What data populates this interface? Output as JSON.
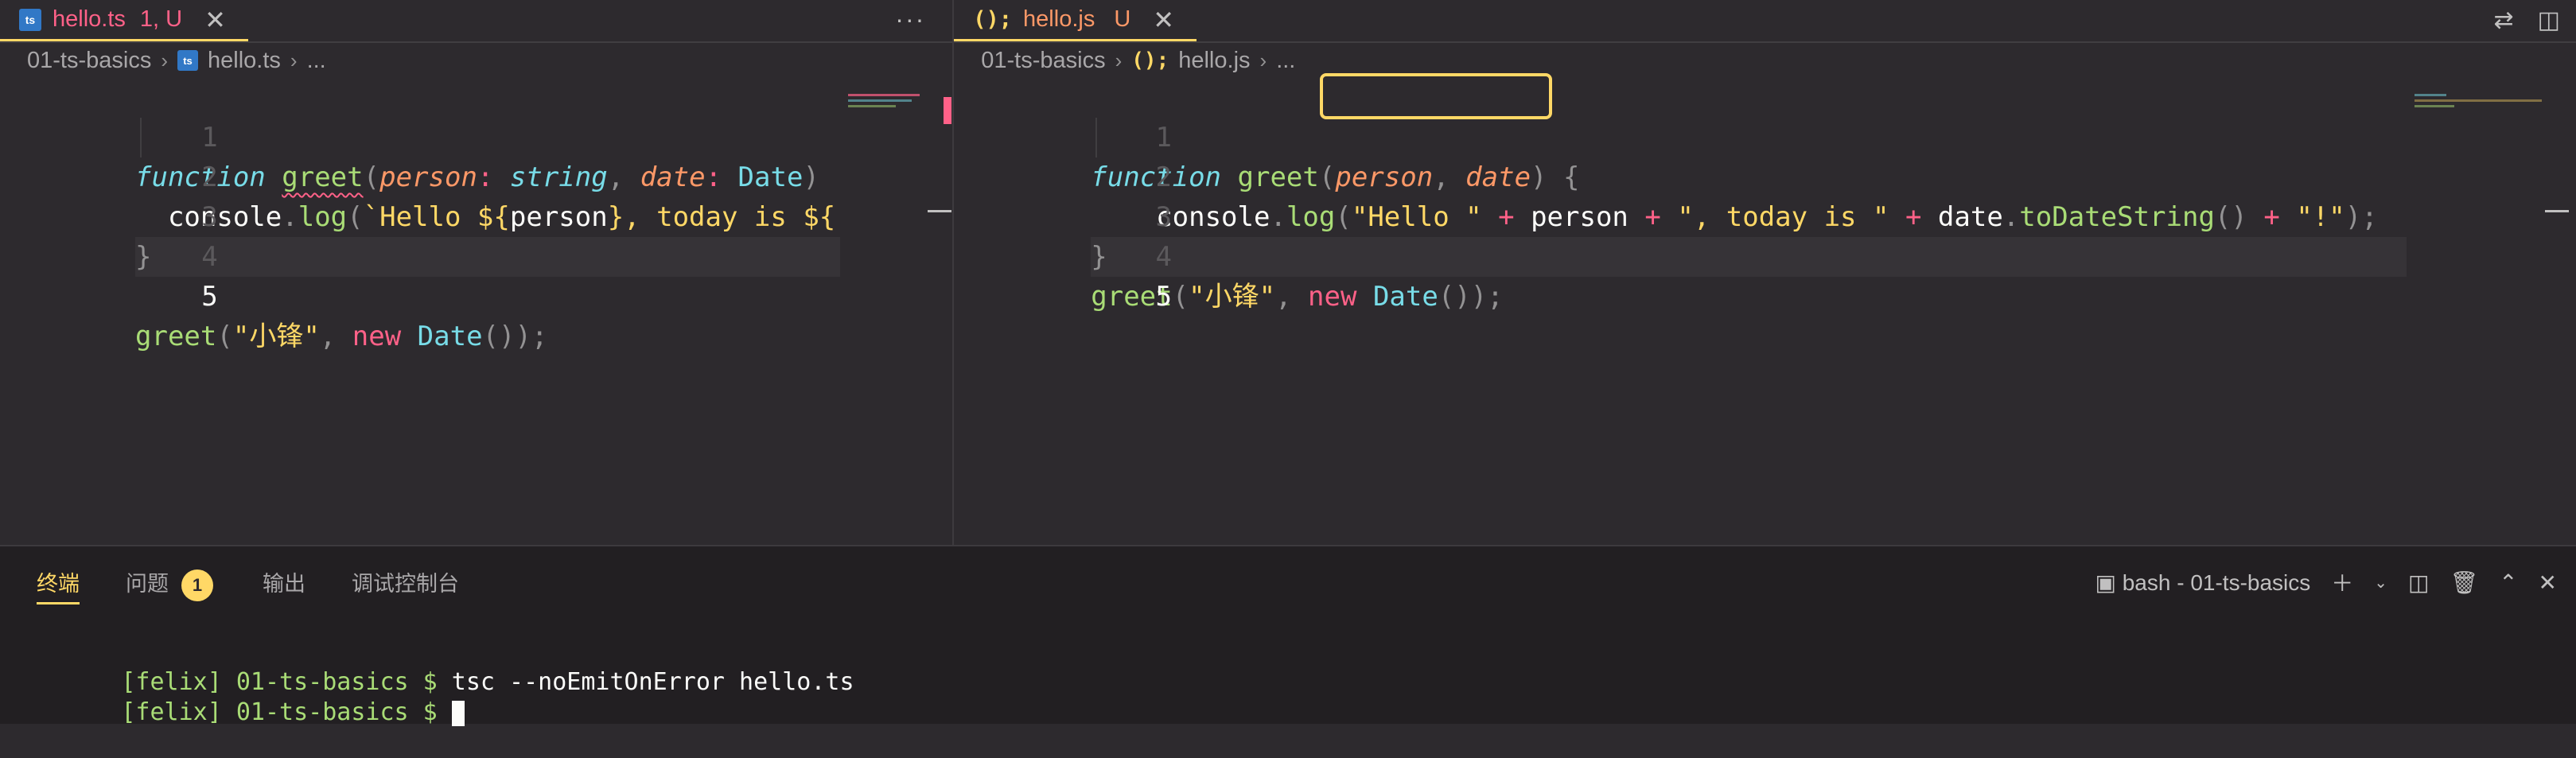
{
  "left_editor": {
    "tab": {
      "icon": "ts",
      "title": "hello.ts",
      "status": "1, U"
    },
    "breadcrumb": {
      "folder": "01-ts-basics",
      "file": "hello.ts",
      "rest": "..."
    },
    "line_numbers": [
      "1",
      "2",
      "3",
      "4",
      "5"
    ],
    "code": {
      "l1": {
        "kw": "function",
        "fn": "greet",
        "p1": "person",
        "t1": "string",
        "p2": "date",
        "t2": "Date"
      },
      "l2": {
        "obj": "console",
        "method": "log",
        "str1": "`Hello ${",
        "var1": "person",
        "str2": "}, today is ${"
      },
      "l3": "}",
      "l5": {
        "fn": "greet",
        "str": "\"小锋\"",
        "kw": "new",
        "cls": "Date"
      }
    }
  },
  "right_editor": {
    "tab": {
      "icon": "(); ",
      "title": "hello.js",
      "status": "U"
    },
    "breadcrumb": {
      "folder": "01-ts-basics",
      "file": "hello.js",
      "rest": "..."
    },
    "line_numbers": [
      "1",
      "2",
      "3",
      "4",
      "5"
    ],
    "code": {
      "l1": {
        "kw": "function",
        "fn": "greet",
        "p1": "person",
        "p2": "date"
      },
      "l2": {
        "obj": "console",
        "method": "log",
        "s1": "\"Hello \"",
        "v1": "person",
        "s2": "\", today is \"",
        "v2": "date",
        "m2": "toDateString",
        "s3": "\"!\""
      },
      "l3": "}",
      "l4": {
        "fn": "greet",
        "str": "\"小锋\"",
        "kw": "new",
        "cls": "Date"
      }
    }
  },
  "panel": {
    "tabs": [
      {
        "label": "终端"
      },
      {
        "label": "问题",
        "badge": "1"
      },
      {
        "label": "输出"
      },
      {
        "label": "调试控制台"
      }
    ],
    "terminal_name": "bash - 01-ts-basics",
    "terminal_lines": [
      {
        "prompt": "[felix] 01-ts-basics $ ",
        "command": "tsc --noEmitOnError hello.ts"
      },
      {
        "prompt": "[felix] 01-ts-basics $ ",
        "command": ""
      }
    ]
  },
  "colors": {
    "background": "#2d2a2e",
    "accent": "#ffd866",
    "error": "#ff6188",
    "keyword": "#78dce8",
    "function": "#a9dc76",
    "parameter": "#fc9867"
  }
}
